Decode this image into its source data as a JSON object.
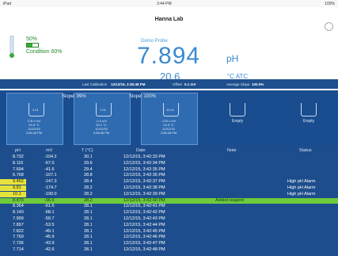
{
  "status_bar": {
    "left": "iPad",
    "time": "3:44 PM",
    "right": "100%"
  },
  "header": {
    "title": "Hanna Lab",
    "battery": "50%",
    "battery_fraction": 0.5,
    "condition": "Condition 60%",
    "probe_name": "Demo Probe",
    "reading": "7.894",
    "unit": "pH",
    "temperature": "20.6",
    "temperature_unit": "°C ATC"
  },
  "info_bar": {
    "last_cal_label": "Last Calibration",
    "last_cal_value": "12/12/15, 3:36:48 PM",
    "offset_label": "Offset",
    "offset_value": "0.1 mV",
    "avg_slope_label": "Average Slope",
    "avg_slope_value": "100.0%"
  },
  "calibration": {
    "slope1": "Slope: 99%",
    "slope2": "Slope: 100%",
    "buffers": [
      {
        "value": "4.01",
        "lines": [
          "178.9 mV",
          "24.8 °C",
          "12/12/15",
          "3:36:48 PM"
        ]
      },
      {
        "value": "7.01",
        "lines": [
          "-0.4 mV",
          "25.1 °C",
          "12/12/15",
          "3:36:48 PM"
        ]
      },
      {
        "value": "10.01",
        "lines": [
          "-178.1 mV",
          "24.9 °C",
          "12/12/15",
          "3:36:48 PM"
        ]
      }
    ],
    "empty1": "Empty",
    "empty2": "Empty"
  },
  "table": {
    "headers": {
      "ph": "pH",
      "mv": "mV",
      "temp": "T (°C)",
      "date": "Date",
      "note": "Note",
      "status": "Status"
    },
    "rows": [
      {
        "ph": "8.732",
        "mv": "-104.2",
        "temp": "30.1",
        "date": "12/12/15, 3:42:33 PM",
        "note": "",
        "status": ""
      },
      {
        "ph": "8.116",
        "mv": "-67.0",
        "temp": "29.6",
        "date": "12/12/15, 3:42:34 PM",
        "note": "",
        "status": ""
      },
      {
        "ph": "7.694",
        "mv": "-41.6",
        "temp": "29.4",
        "date": "12/12/15, 3:42:35 PM",
        "note": "",
        "status": ""
      },
      {
        "ph": "6.768",
        "mv": "-107.1",
        "temp": "28.8",
        "date": "12/12/15, 3:42:36 PM",
        "note": "",
        "status": ""
      },
      {
        "ph": "9.462",
        "mv": "-147.3",
        "temp": "28.4",
        "date": "12/12/15, 3:42:37 PM",
        "note": "",
        "status": "High pH Alarm"
      },
      {
        "ph": "9.81",
        "mv": "-174.7",
        "temp": "28.2",
        "date": "12/12/15, 3:42:38 PM",
        "note": "",
        "status": "High pH Alarm"
      },
      {
        "ph": "10.1",
        "mv": "-190.0",
        "temp": "28.2",
        "date": "12/12/15, 3:42:39 PM",
        "note": "",
        "status": "High pH Alarm"
      },
      {
        "ph": "8.470",
        "mv": "-96.6",
        "temp": "28.2",
        "date": "12/12/15, 3:42:40 PM",
        "note": "Added reagent",
        "status": ""
      },
      {
        "ph": "8.364",
        "mv": "-61.5",
        "temp": "28.1",
        "date": "12/12/15, 3:42:41 PM",
        "note": "",
        "status": ""
      },
      {
        "ph": "8.140",
        "mv": "-68.1",
        "temp": "28.1",
        "date": "12/12/15, 3:42:42 PM",
        "note": "",
        "status": ""
      },
      {
        "ph": "7.999",
        "mv": "-59.7",
        "temp": "28.1",
        "date": "12/12/15, 3:42:43 PM",
        "note": "",
        "status": ""
      },
      {
        "ph": "7.897",
        "mv": "-53.5",
        "temp": "28.1",
        "date": "12/12/15, 3:42:44 PM",
        "note": "",
        "status": ""
      },
      {
        "ph": "7.822",
        "mv": "-49.1",
        "temp": "28.1",
        "date": "12/12/15, 3:42:45 PM",
        "note": "",
        "status": ""
      },
      {
        "ph": "7.769",
        "mv": "-45.9",
        "temp": "28.1",
        "date": "12/12/15, 3:42:46 PM",
        "note": "",
        "status": ""
      },
      {
        "ph": "7.736",
        "mv": "-43.9",
        "temp": "28.1",
        "date": "12/12/15, 3:42:47 PM",
        "note": "",
        "status": ""
      },
      {
        "ph": "7.714",
        "mv": "-42.6",
        "temp": "28.1",
        "date": "12/12/15, 3:42:48 PM",
        "note": "",
        "status": ""
      }
    ]
  }
}
